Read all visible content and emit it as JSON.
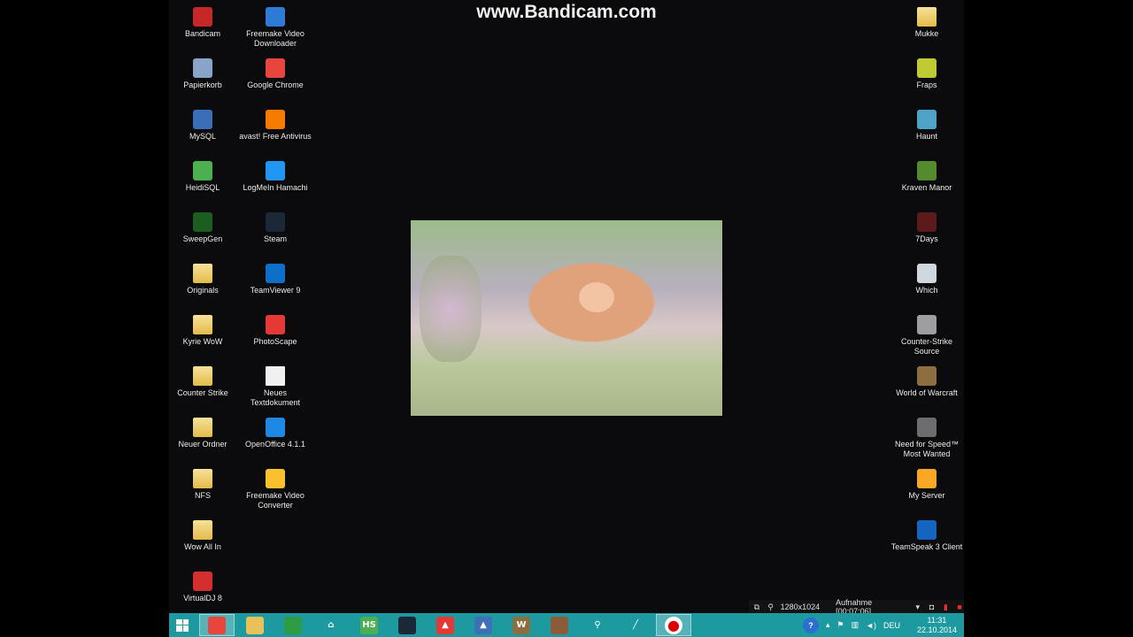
{
  "watermark": "www.Bandicam.com",
  "desktop": {
    "left_column_1": [
      {
        "label": "Bandicam",
        "icon": "bandicam-icon",
        "color": "#c62828"
      },
      {
        "label": "Papierkorb",
        "icon": "recycle-bin-icon",
        "color": "#8aa4c8"
      },
      {
        "label": "MySQL",
        "icon": "mysql-icon",
        "color": "#3a6fb8"
      },
      {
        "label": "HeidiSQL",
        "icon": "heidisql-icon",
        "color": "#4caf50"
      },
      {
        "label": "SweepGen",
        "icon": "sweepgen-icon",
        "color": "#1b5e20"
      },
      {
        "label": "Originals",
        "icon": "folder-icon",
        "color": "folder"
      },
      {
        "label": "Kyrie WoW",
        "icon": "folder-icon",
        "color": "folder"
      },
      {
        "label": "Counter Strike",
        "icon": "folder-icon",
        "color": "folder"
      },
      {
        "label": "Neuer Ordner",
        "icon": "folder-icon",
        "color": "folder"
      },
      {
        "label": "NFS",
        "icon": "folder-icon",
        "color": "folder"
      },
      {
        "label": "Wow All In",
        "icon": "folder-icon",
        "color": "folder"
      },
      {
        "label": "VirtualDJ 8",
        "icon": "virtualdj-icon",
        "color": "#d32f2f"
      }
    ],
    "left_column_2": [
      {
        "label": "Freemake Video\nDownloader",
        "icon": "freemake-downloader-icon",
        "color": "#2e7bd6"
      },
      {
        "label": "Google Chrome",
        "icon": "chrome-icon",
        "color": "#e8453c"
      },
      {
        "label": "avast! Free Antivirus",
        "icon": "avast-icon",
        "color": "#f57c00"
      },
      {
        "label": "LogMeIn Hamachi",
        "icon": "hamachi-icon",
        "color": "#2196f3"
      },
      {
        "label": "Steam",
        "icon": "steam-icon",
        "color": "#1b2838"
      },
      {
        "label": "TeamViewer 9",
        "icon": "teamviewer-icon",
        "color": "#0e6fc9"
      },
      {
        "label": "PhotoScape",
        "icon": "photoscape-icon",
        "color": "#e53935"
      },
      {
        "label": "Neues\nTextdokument",
        "icon": "text-document-icon",
        "color": "file"
      },
      {
        "label": "OpenOffice 4.1.1",
        "icon": "openoffice-icon",
        "color": "#1e88e5"
      },
      {
        "label": "Freemake Video\nConverter",
        "icon": "freemake-converter-icon",
        "color": "#fbc02d"
      }
    ],
    "right_column": [
      {
        "label": "Mukke",
        "icon": "folder-icon",
        "color": "folder"
      },
      {
        "label": "Fraps",
        "icon": "fraps-icon",
        "color": "#c0ca33"
      },
      {
        "label": "Haunt",
        "icon": "haunt-icon",
        "color": "#4fa3c7"
      },
      {
        "label": "Kraven Manor",
        "icon": "kraven-manor-icon",
        "color": "#558b2f"
      },
      {
        "label": "7Days",
        "icon": "7days-icon",
        "color": "#5d1a1a"
      },
      {
        "label": "Which",
        "icon": "which-icon",
        "color": "#cfd8dc"
      },
      {
        "label": "Counter-Strike\nSource",
        "icon": "counter-strike-icon",
        "color": "#9e9e9e"
      },
      {
        "label": "World of Warcraft",
        "icon": "wow-icon",
        "color": "#8d6e3f"
      },
      {
        "label": "Need for Speed™\nMost Wanted",
        "icon": "nfs-icon",
        "color": "#6d6d6d"
      },
      {
        "label": "My Server",
        "icon": "server-icon",
        "color": "#f9a825"
      },
      {
        "label": "TeamSpeak 3 Client",
        "icon": "teamspeak-icon",
        "color": "#1565c0"
      }
    ]
  },
  "bandicam_bar": {
    "resolution": "1280x1024",
    "status": "Aufnahme [00:07:06]"
  },
  "taskbar": {
    "items": [
      {
        "name": "chrome",
        "icon": "chrome-icon",
        "color": "#e8453c",
        "glyph": "",
        "active": true
      },
      {
        "name": "explorer",
        "icon": "file-explorer-icon",
        "color": "#e8c15a",
        "glyph": "",
        "active": false
      },
      {
        "name": "store",
        "icon": "store-icon",
        "color": "#2e9b45",
        "glyph": "",
        "active": false
      },
      {
        "name": "home",
        "icon": "home-icon",
        "color": "#1d9aa0",
        "glyph": "⌂",
        "active": false
      },
      {
        "name": "heidisql",
        "icon": "heidisql-icon",
        "color": "#4caf50",
        "glyph": "HS",
        "active": false
      },
      {
        "name": "steam",
        "icon": "steam-icon",
        "color": "#1b2838",
        "glyph": "",
        "active": false
      },
      {
        "name": "avast",
        "icon": "alert-icon",
        "color": "#e53935",
        "glyph": "▲",
        "active": false
      },
      {
        "name": "app-blue",
        "icon": "triangle-app-icon",
        "color": "#3f6fb5",
        "glyph": "▲",
        "active": false
      },
      {
        "name": "wow",
        "icon": "wow-icon",
        "color": "#8d6e3f",
        "glyph": "W",
        "active": false
      },
      {
        "name": "game",
        "icon": "game-icon",
        "color": "#8d5a3a",
        "glyph": "",
        "active": false
      },
      {
        "name": "search",
        "icon": "magnifier-icon",
        "color": "#1d9aa0",
        "glyph": "⚲",
        "active": false
      },
      {
        "name": "tool",
        "icon": "pen-icon",
        "color": "#1d9aa0",
        "glyph": "╱",
        "active": false
      },
      {
        "name": "bandicam",
        "icon": "record-icon",
        "color": "#ffffff",
        "glyph": "●",
        "active": true
      }
    ],
    "tray": {
      "language": "DEU",
      "time": "11:31",
      "date": "22.10.2014"
    }
  }
}
